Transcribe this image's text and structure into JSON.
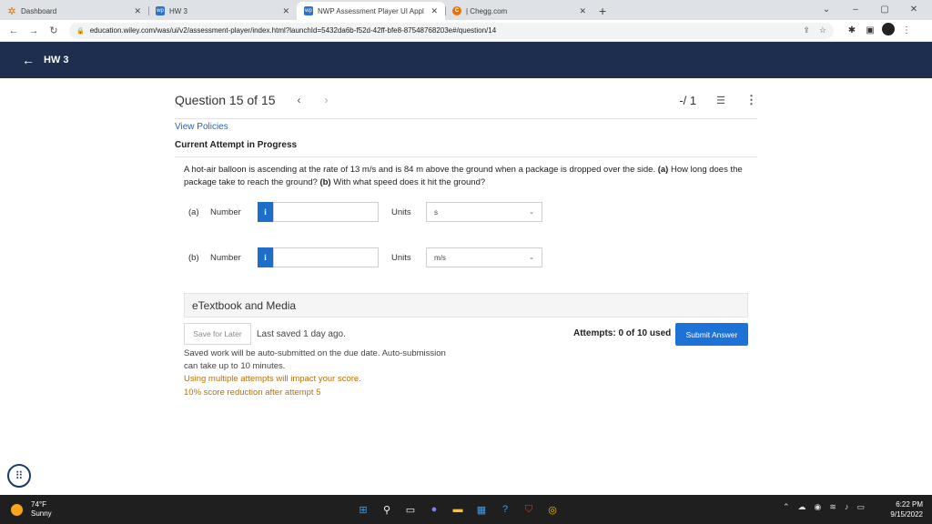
{
  "browser": {
    "tabs": [
      {
        "label": "Dashboard",
        "icon": "gear-icon"
      },
      {
        "label": "HW 3",
        "icon": "wp-icon"
      },
      {
        "label": "NWP Assessment Player UI Appl",
        "icon": "wp-icon"
      },
      {
        "label": "| Chegg.com",
        "icon": "chegg-icon"
      }
    ],
    "url": "education.wiley.com/was/ui/v2/assessment-player/index.html?launchId=5432da6b-f52d-42ff-bfe8-87548768203e#/question/14"
  },
  "app": {
    "title": "HW 3"
  },
  "question": {
    "title": "Question 15 of 15",
    "score": "-/ 1",
    "view_policies": "View Policies",
    "attempt_status": "Current Attempt in Progress",
    "text": "A hot-air balloon is ascending at the rate of 13 m/s and is 84 m above the ground when a package is dropped over the side.",
    "part_a_label": "(a)",
    "part_a_text": "How long does the package take to reach the ground?",
    "part_b_label": "(b)",
    "part_b_text": "With what speed does it hit the ground?",
    "inputs": [
      {
        "part": "(a)",
        "number_label": "Number",
        "number_value": "",
        "units_label": "Units",
        "units_value": "s"
      },
      {
        "part": "(b)",
        "number_label": "Number",
        "number_value": "",
        "units_label": "Units",
        "units_value": "m/s"
      }
    ],
    "etextbook": "eTextbook and Media",
    "save_later": "Save for Later",
    "last_saved": "Last saved 1 day ago.",
    "attempts": "Attempts: 0 of 10 used",
    "submit": "Submit Answer",
    "autosubmit": "Saved work will be auto-submitted on the due date. Auto-submission can take up to 10 minutes.",
    "warn1": "Using multiple attempts will impact your score.",
    "warn2": "10% score reduction after attempt 5"
  },
  "taskbar": {
    "temp": "74°F",
    "weather": "Sunny",
    "time": "6:22 PM",
    "date": "9/15/2022"
  },
  "colors": {
    "appbar": "#1e2e4f",
    "link": "#2367c5",
    "submit": "#1d72d8",
    "warning": "#b7700a"
  }
}
